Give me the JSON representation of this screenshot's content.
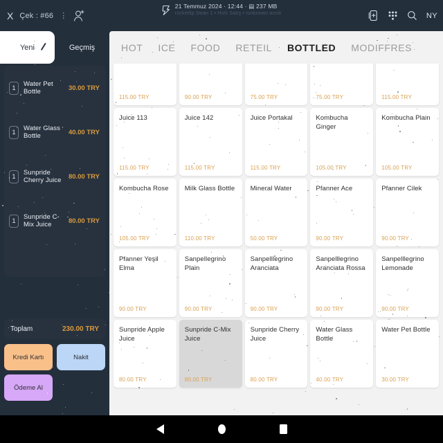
{
  "topbar": {
    "close_label": "X",
    "check_label": "Çek : #66",
    "menu_dots": "⋮",
    "add_user_icon": "add-user-icon",
    "logo_icon": "app-logo-icon",
    "datetime": "21 Temmuz 2024 · 12:44 ·",
    "memory": "237 MB",
    "subtitle": "rocketlip Swan 1 • Hızlı Satış • runknown wssb",
    "icons": [
      "add-card-icon",
      "keypad-icon",
      "search-icon"
    ],
    "user_initials": "NY"
  },
  "order_panel": {
    "tabs": [
      {
        "label": "Yeni",
        "active": true
      },
      {
        "label": "Geçmiş",
        "active": false
      }
    ],
    "items": [
      {
        "qty": "1",
        "name": "Water Pet Bottle",
        "price": "30.00 TRY"
      },
      {
        "qty": "1",
        "name": "Water Glass Bottle",
        "price": "40.00 TRY"
      },
      {
        "qty": "1",
        "name": "Sunpride Cherry Juice",
        "price": "80.00 TRY"
      },
      {
        "qty": "1",
        "name": "Sunpride C-Mix Juice",
        "price": "80.00 TRY"
      }
    ],
    "total_label": "Toplam",
    "total_value": "230.00 TRY",
    "payment_buttons": [
      {
        "label": "Kredi Kartı",
        "color": "#f9c08a"
      },
      {
        "label": "Nakit",
        "color": "#bbd6f7"
      },
      {
        "label": "Ödeme Al",
        "color": "#d6a8f7"
      }
    ]
  },
  "categories": [
    {
      "label": "HOT",
      "active": false
    },
    {
      "label": "ICE",
      "active": false
    },
    {
      "label": "FOOD",
      "active": false
    },
    {
      "label": "RETEIL",
      "active": false
    },
    {
      "label": "BOTTLED",
      "active": true
    },
    {
      "label": "MODIFFRES",
      "active": false
    }
  ],
  "products": [
    {
      "name": "",
      "price": "115.00 TRY",
      "selected": false
    },
    {
      "name": "",
      "price": "90.00 TRY",
      "selected": false
    },
    {
      "name": "",
      "price": "75.00 TRY",
      "selected": false
    },
    {
      "name": "",
      "price": "75.00 TRY",
      "selected": false
    },
    {
      "name": "",
      "price": "115.00 TRY",
      "selected": false
    },
    {
      "name": "Juice 113",
      "price": "115.00 TRY",
      "selected": false
    },
    {
      "name": "Juice 142",
      "price": "115.00 TRY",
      "selected": false
    },
    {
      "name": "Juice Portakal",
      "price": "115.00 TRY",
      "selected": false
    },
    {
      "name": "Kombucha Ginger",
      "price": "105.00 TRY",
      "selected": false
    },
    {
      "name": "Kombucha Plain",
      "price": "105.00 TRY",
      "selected": false
    },
    {
      "name": "Kombucha Rose",
      "price": "105.00 TRY",
      "selected": false
    },
    {
      "name": "Milk Glass Bottle",
      "price": "110.00 TRY",
      "selected": false
    },
    {
      "name": "Mineral Water",
      "price": "50.00 TRY",
      "selected": false
    },
    {
      "name": "Pfanner Ace",
      "price": "90.00 TRY",
      "selected": false
    },
    {
      "name": "Pfanner Cilek",
      "price": "90.00 TRY",
      "selected": false
    },
    {
      "name": "Pfanner Yeşil Elma",
      "price": "90.00 TRY",
      "selected": false
    },
    {
      "name": "Sanpellegrino Plain",
      "price": "90.00 TRY",
      "selected": false
    },
    {
      "name": "Sanpelllegrino Aranciata",
      "price": "90.00 TRY",
      "selected": false
    },
    {
      "name": "Sanpelllegrino Aranciata Rossa",
      "price": "90.00 TRY",
      "selected": false
    },
    {
      "name": "Sanpelllegrino Lemonade",
      "price": "90.00 TRY",
      "selected": false
    },
    {
      "name": "Sunpride Apple Juice",
      "price": "80.00 TRY",
      "selected": false
    },
    {
      "name": "Sunpride C-Mix Juice",
      "price": "80.00 TRY",
      "selected": true
    },
    {
      "name": "Sunpride Cherry Juice",
      "price": "80.00 TRY",
      "selected": false
    },
    {
      "name": "Water Glass Bottle",
      "price": "40.00 TRY",
      "selected": false
    },
    {
      "name": "Water Pet Bottle",
      "price": "30.00 TRY",
      "selected": false
    }
  ],
  "navbar": {
    "back": "back-icon",
    "home": "home-icon",
    "recents": "recents-icon"
  },
  "colors": {
    "panel_bg": "#242f3c",
    "accent_price": "#d99a3e",
    "grid_bg": "#f2f2f2"
  }
}
